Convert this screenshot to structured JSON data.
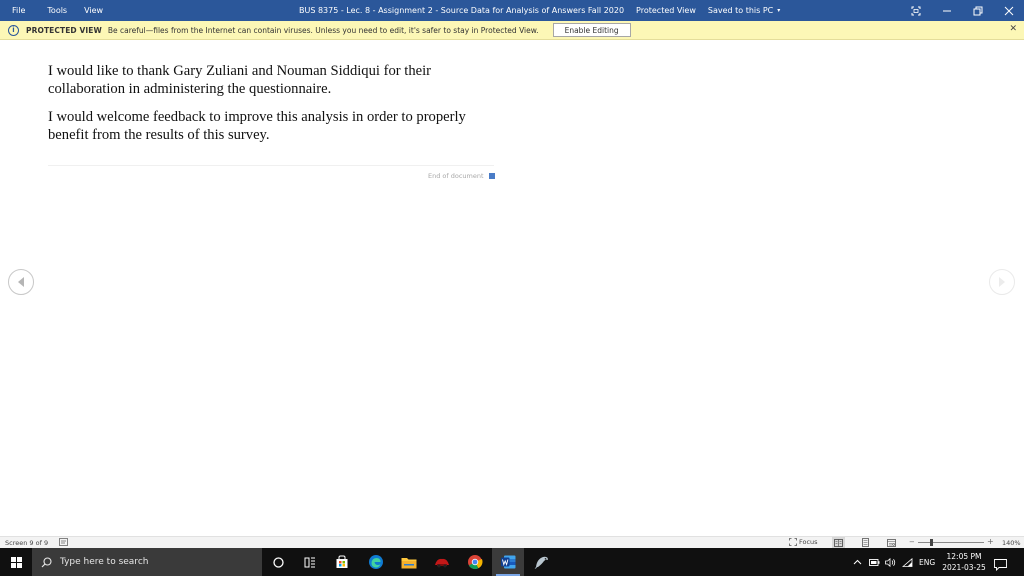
{
  "menu": {
    "file": "File",
    "tools": "Tools",
    "view": "View"
  },
  "title": {
    "document": "BUS 8375 - Lec. 8 - Assignment 2 - Source Data for Analysis of Answers Fall 2020",
    "mode": "Protected View",
    "saved": "Saved to this PC",
    "saved_caret": "▾"
  },
  "protected_bar": {
    "title": "PROTECTED VIEW",
    "message": "Be careful—files from the Internet can contain viruses. Unless you need to edit, it's safer to stay in Protected View.",
    "enable_label": "Enable Editing",
    "close": "✕"
  },
  "document": {
    "paragraphs": [
      "I would like to thank Gary Zuliani and Nouman Siddiqui for their collaboration in administering the questionnaire.",
      "I would welcome feedback to improve this analysis in order to properly benefit from the results of this survey."
    ],
    "end_label": "End of document"
  },
  "statusbar": {
    "screen": "Screen 9 of 9",
    "focus": "Focus",
    "zoom_minus": "−",
    "zoom_plus": "+",
    "zoom": "140%",
    "zoom_level_fraction": 0.2
  },
  "taskbar": {
    "search_placeholder": "Type here to search",
    "language": "ENG",
    "time": "12:05 PM",
    "date": "2021-03-25"
  },
  "colors": {
    "word_blue": "#2b579a",
    "protected_yellow": "#fcf7b6",
    "taskbar": "#101010"
  }
}
